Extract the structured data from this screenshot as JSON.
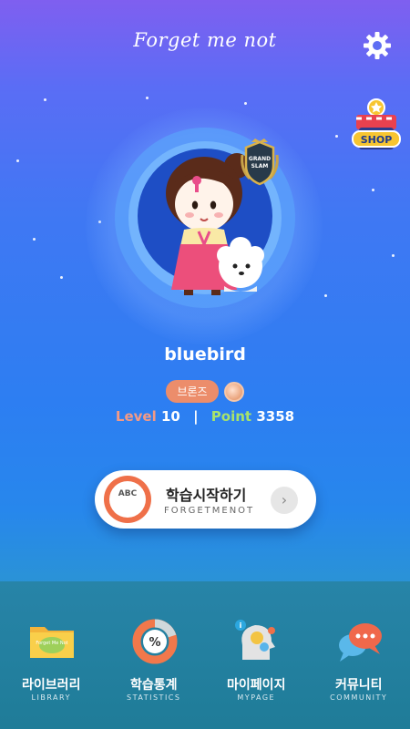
{
  "header": {
    "title": "Forget me not",
    "settings_icon": "gear-icon"
  },
  "shop": {
    "label": "SHOP",
    "icon": "shop-icon"
  },
  "profile": {
    "emblem_lines": [
      "GRAND",
      "SLAM"
    ],
    "username": "bluebird",
    "rank": "브론즈",
    "level_label": "Level",
    "level_value": "10",
    "separator": "|",
    "point_label": "Point",
    "point_value": "3358"
  },
  "start": {
    "icon_text": "ABC",
    "title": "학습시작하기",
    "subtitle": "FORGETMENOT",
    "arrow": "›"
  },
  "nav": [
    {
      "label": "라이브러리",
      "sub": "LIBRARY",
      "icon": "folder-icon",
      "icon_text": "Forget Me Not"
    },
    {
      "label": "학습통계",
      "sub": "STATISTICS",
      "icon": "donut-chart-icon",
      "icon_text": "%"
    },
    {
      "label": "마이페이지",
      "sub": "MYPAGE",
      "icon": "profile-gears-icon",
      "icon_text": "i"
    },
    {
      "label": "커뮤니티",
      "sub": "COMMUNITY",
      "icon": "chat-bubbles-icon",
      "icon_text": ""
    }
  ],
  "colors": {
    "rank_badge": "#ec8d6b",
    "level_label": "#f39a86",
    "point_label": "#a8e36b",
    "start_icon": "#ef7049"
  }
}
